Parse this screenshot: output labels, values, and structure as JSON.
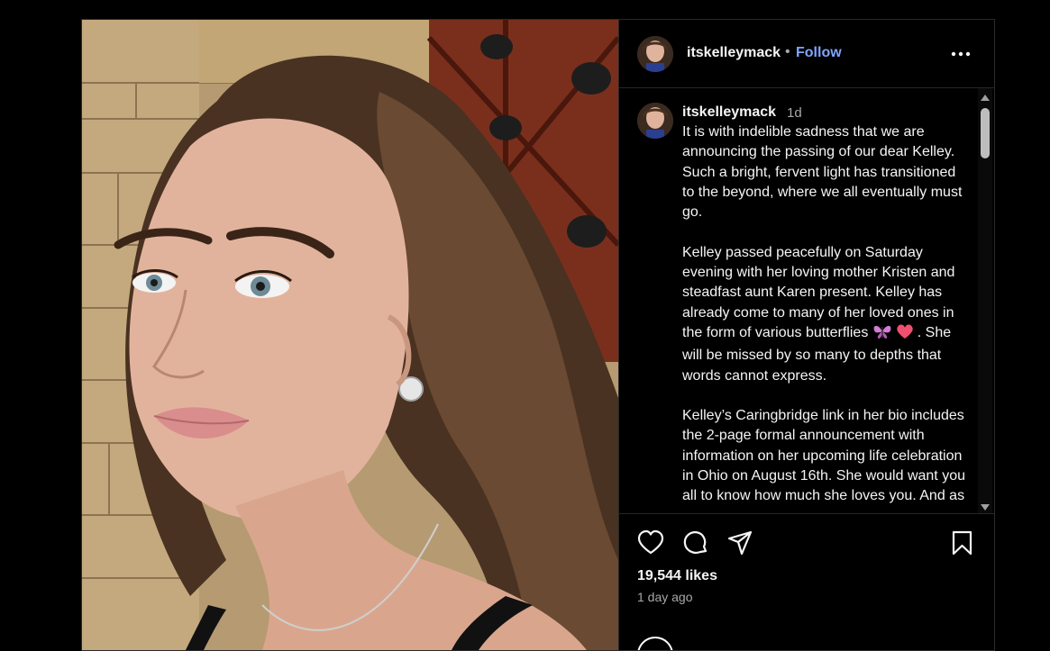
{
  "post": {
    "username": "itskelleymack",
    "follow_separator": "•",
    "follow_label": "Follow",
    "caption": {
      "username": "itskelleymack",
      "time": "1d",
      "paragraph1": "It is with indelible sadness that we are announcing the passing of our dear Kelley. Such a bright, fervent light has transitioned to the beyond, where we all eventually must go.",
      "paragraph2_start": "Kelley passed peacefully on Saturday evening with her loving mother Kristen and steadfast aunt Karen present. Kelley has already come to many of her loved ones in the form of various butterflies",
      "paragraph2_end": ". She will be missed by so many to depths that words cannot express.",
      "paragraph3": "Kelley’s Caringbridge link in her bio includes the 2-page formal announcement with information on her upcoming life celebration in Ohio on August 16th. She would want you all to know how much she loves you. And as"
    },
    "likes": "19,544 likes",
    "posted_ago": "1 day ago"
  },
  "icons": {
    "more": "more-options-icon",
    "like": "heart-icon",
    "comment": "comment-bubble-icon",
    "share": "paper-plane-icon",
    "save": "bookmark-icon",
    "emoji1": "butterfly-emoji",
    "emoji2": "heart-emoji"
  },
  "colors": {
    "background": "#000000",
    "follow": "#7ea6ff",
    "text": "#f5f5f5",
    "muted": "#a8a8a8",
    "divider": "#262626"
  }
}
